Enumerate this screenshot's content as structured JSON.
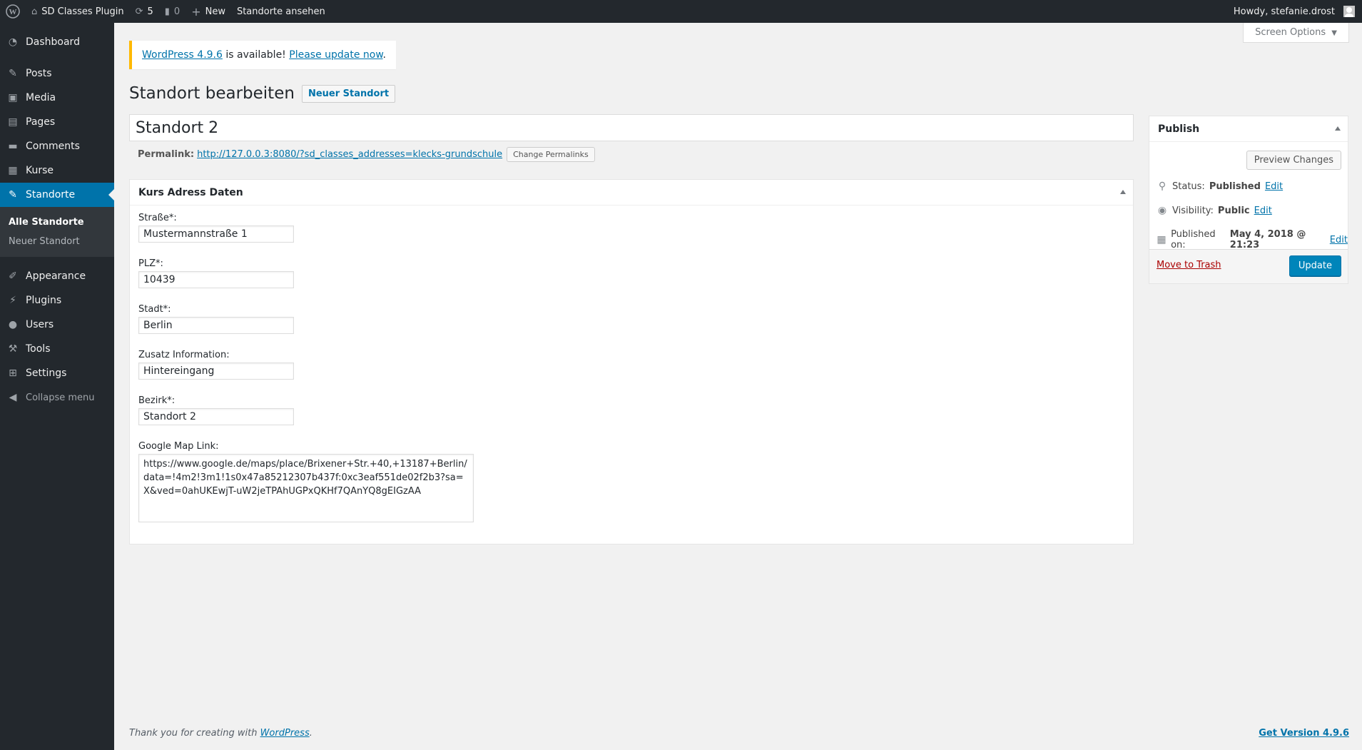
{
  "adminbar": {
    "site_name": "SD Classes Plugin",
    "updates_count": "5",
    "comments_count": "0",
    "new_label": "New",
    "view_label": "Standorte ansehen",
    "howdy": "Howdy, stefanie.drost"
  },
  "sidebar": {
    "items_top": [
      {
        "label": "Dashboard",
        "icon": "dashboard-icon"
      },
      {
        "label": "Posts",
        "icon": "pin-icon"
      },
      {
        "label": "Media",
        "icon": "media-icon"
      },
      {
        "label": "Pages",
        "icon": "pages-icon"
      },
      {
        "label": "Comments",
        "icon": "comments-icon"
      },
      {
        "label": "Kurse",
        "icon": "calendar-icon"
      },
      {
        "label": "Standorte",
        "icon": "pin-icon"
      }
    ],
    "submenu": [
      "Alle Standorte",
      "Neuer Standort"
    ],
    "items_bottom": [
      {
        "label": "Appearance",
        "icon": "appearance-icon"
      },
      {
        "label": "Plugins",
        "icon": "plugins-icon"
      },
      {
        "label": "Users",
        "icon": "users-icon"
      },
      {
        "label": "Tools",
        "icon": "tools-icon"
      },
      {
        "label": "Settings",
        "icon": "settings-icon"
      }
    ],
    "collapse": "Collapse menu"
  },
  "screen_options": "Screen Options",
  "notice": {
    "version_link": "WordPress 4.9.6",
    "text": " is available! ",
    "update_link": "Please update now",
    "end": "."
  },
  "page": {
    "title": "Standort bearbeiten",
    "add_new": "Neuer Standort",
    "post_title": "Standort 2",
    "permalink_label": "Permalink:",
    "permalink_url": "http://127.0.0.3:8080/?sd_classes_addresses=klecks-grundschule",
    "change_permalinks": "Change Permalinks"
  },
  "adress_box": {
    "title": "Kurs Adress Daten",
    "fields": [
      {
        "label": "Straße*:",
        "value": "Mustermannstraße 1"
      },
      {
        "label": "PLZ*:",
        "value": "10439"
      },
      {
        "label": "Stadt*:",
        "value": "Berlin"
      },
      {
        "label": "Zusatz Information:",
        "value": "Hintereingang"
      },
      {
        "label": "Bezirk*:",
        "value": "Standort 2"
      }
    ],
    "map_label": "Google Map Link:",
    "map_value": "https://www.google.de/maps/place/Brixener+Str.+40,+13187+Berlin/data=!4m2!3m1!1s0x47a85212307b437f:0xc3eaf551de02f2b3?sa=X&ved=0ahUKEwjT-uW2jeTPAhUGPxQKHf7QAnYQ8gEIGzAA"
  },
  "publish": {
    "title": "Publish",
    "preview": "Preview Changes",
    "status_label": "Status:",
    "status_value": "Published",
    "visibility_label": "Visibility:",
    "visibility_value": "Public",
    "published_label": "Published on:",
    "published_value": "May 4, 2018 @ 21:23",
    "edit": "Edit",
    "trash": "Move to Trash",
    "update": "Update"
  },
  "footer": {
    "thanks": "Thank you for creating with ",
    "wp_link": "WordPress",
    "end": ".",
    "version": "Get Version 4.9.6"
  },
  "colors": {
    "admin_dark": "#23282d",
    "accent": "#0073aa",
    "notice_warning": "#ffb900",
    "trash": "#a00"
  }
}
